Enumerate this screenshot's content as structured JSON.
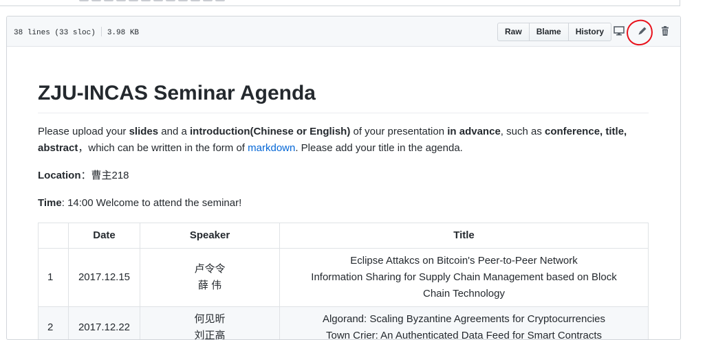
{
  "file_header": {
    "lines": "38 lines (33 sloc)",
    "size": "3.98 KB",
    "buttons": {
      "raw": "Raw",
      "blame": "Blame",
      "history": "History"
    },
    "icons": [
      "desktop-icon",
      "pencil-icon",
      "trash-icon"
    ]
  },
  "readme": {
    "title": "ZJU-INCAS Seminar Agenda",
    "intro": {
      "t1": "Please upload your ",
      "b1": "slides",
      "t2": " and a ",
      "b2": "introduction(Chinese or English)",
      "t3": " of your presentation ",
      "b3": "in advance",
      "t4": ", such as ",
      "b4": "conference, title, abstract",
      "t5": "，which can be written in the form of ",
      "link": "markdown",
      "t6": ". Please add your title in the agenda."
    },
    "location": {
      "label": "Location",
      "value": "：曹主218"
    },
    "time": {
      "label": "Time",
      "value": ": 14:00 Welcome to attend the seminar!"
    },
    "table": {
      "headers": [
        "",
        "Date",
        "Speaker",
        "Title"
      ],
      "rows": [
        {
          "num": "1",
          "date": "2017.12.15",
          "speakers": [
            "卢令令",
            "薛 伟"
          ],
          "titles": [
            "Eclipse Attakcs on Bitcoin's Peer-to-Peer Network",
            "Information Sharing for Supply Chain Management based on Block",
            "Chain Technology"
          ]
        },
        {
          "num": "2",
          "date": "2017.12.22",
          "speakers": [
            "何见昕",
            "刘正高"
          ],
          "titles": [
            "Algorand: Scaling Byzantine Agreements for Cryptocurrencies",
            "Town Crier: An Authenticated Data Feed for Smart Contracts"
          ]
        }
      ]
    }
  },
  "annotation": {
    "color": "#e8111b"
  }
}
